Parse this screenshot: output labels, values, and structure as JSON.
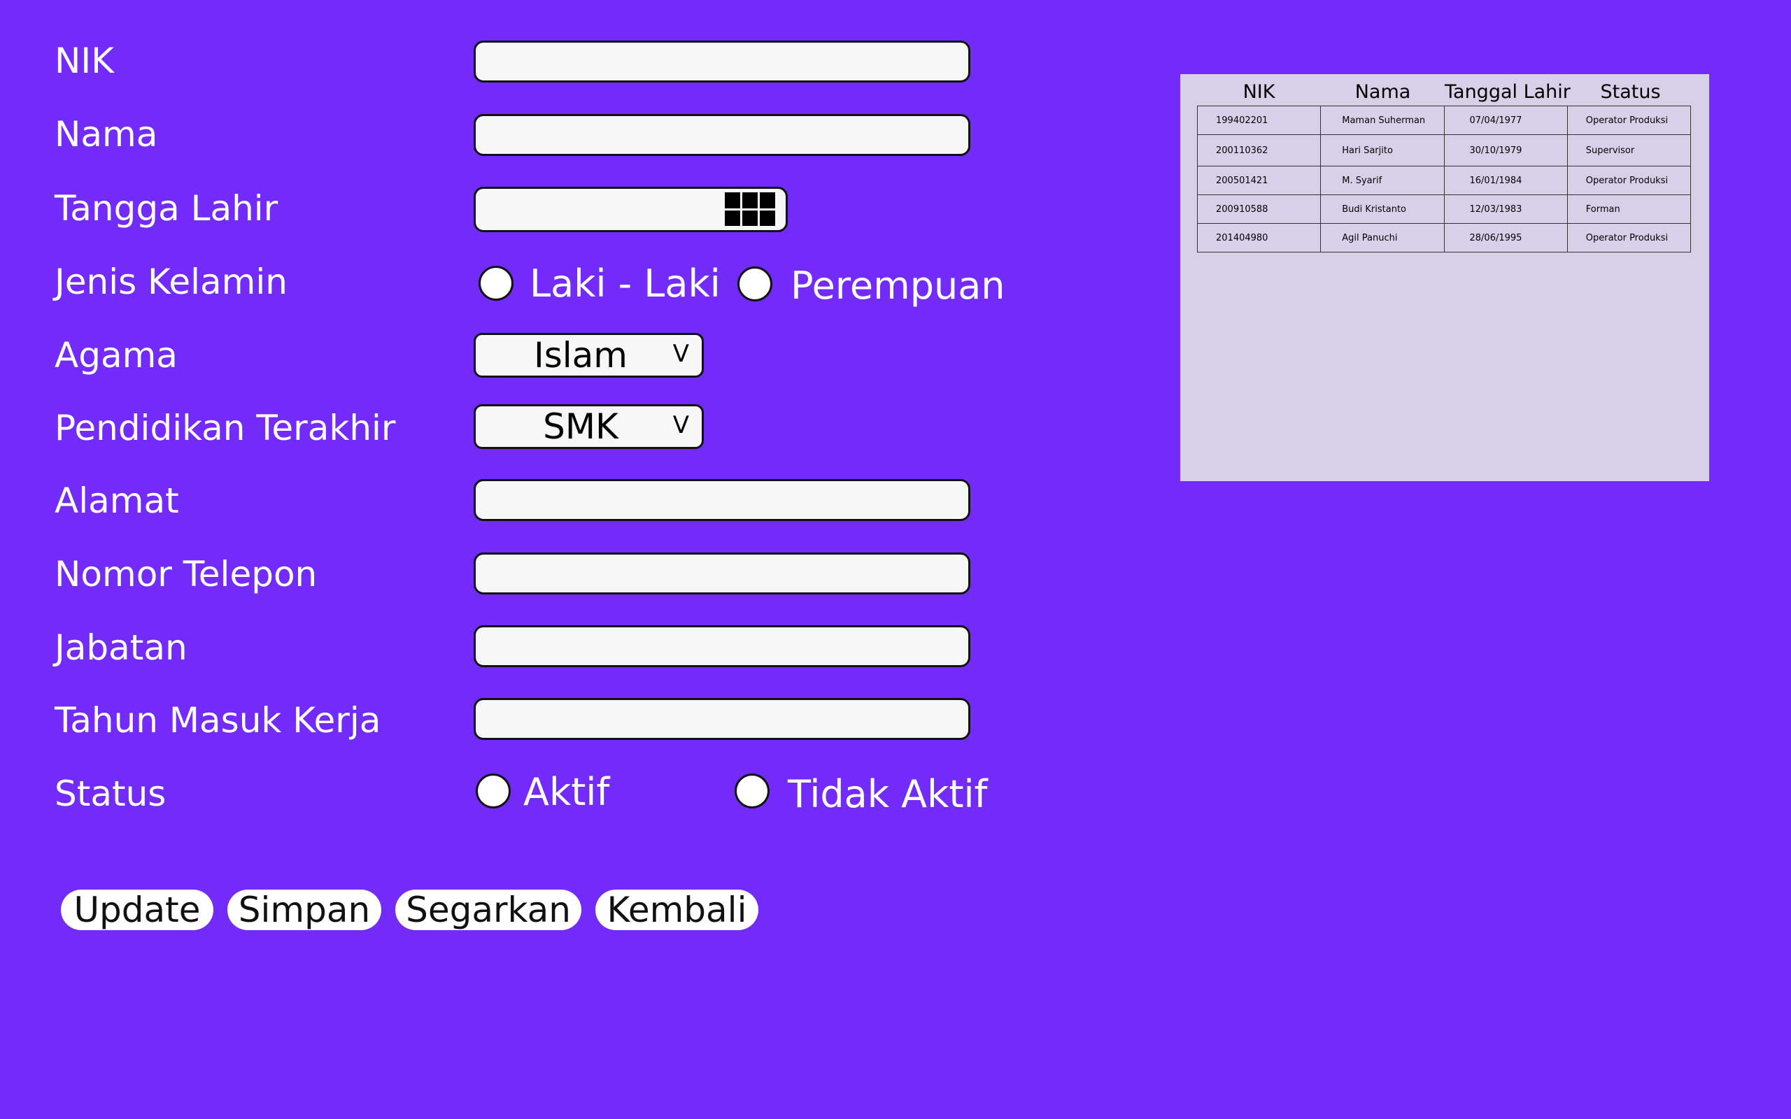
{
  "form": {
    "labels": {
      "nik": "NIK",
      "nama": "Nama",
      "tanggal_lahir": "Tangga Lahir",
      "jenis_kelamin": "Jenis Kelamin",
      "agama": "Agama",
      "pendidikan": "Pendidikan Terakhir",
      "alamat": "Alamat",
      "telepon": "Nomor Telepon",
      "jabatan": "Jabatan",
      "tahun_masuk": "Tahun Masuk Kerja",
      "status": "Status"
    },
    "values": {
      "nik": "",
      "nama": "",
      "tanggal_lahir": "",
      "alamat": "",
      "telepon": "",
      "jabatan": "",
      "tahun_masuk": ""
    },
    "gender_options": [
      "Laki - Laki",
      "Perempuan"
    ],
    "agama_selected": "Islam",
    "pendidikan_selected": "SMK",
    "dropdown_arrow": "V",
    "status_options": [
      "Aktif",
      "Tidak Aktif"
    ]
  },
  "buttons": {
    "update": "Update",
    "simpan": "Simpan",
    "segarkan": "Segarkan",
    "kembali": "Kembali"
  },
  "table": {
    "headers": [
      "NIK",
      "Nama",
      "Tanggal Lahir",
      "Status"
    ],
    "rows": [
      [
        "199402201",
        "Maman Suherman",
        "07/04/1977",
        "Operator Produksi"
      ],
      [
        "200110362",
        "Hari Sarjito",
        "30/10/1979",
        "Supervisor"
      ],
      [
        "200501421",
        "M. Syarif",
        "16/01/1984",
        "Operator Produksi"
      ],
      [
        "200910588",
        "Budi Kristanto",
        "12/03/1983",
        "Forman"
      ],
      [
        "201404980",
        "Agil Panuchi",
        "28/06/1995",
        "Operator Produksi"
      ]
    ]
  },
  "colors": {
    "background": "#722BF9",
    "field": "#F7F7F7",
    "table_panel": "#D8D0E8"
  }
}
